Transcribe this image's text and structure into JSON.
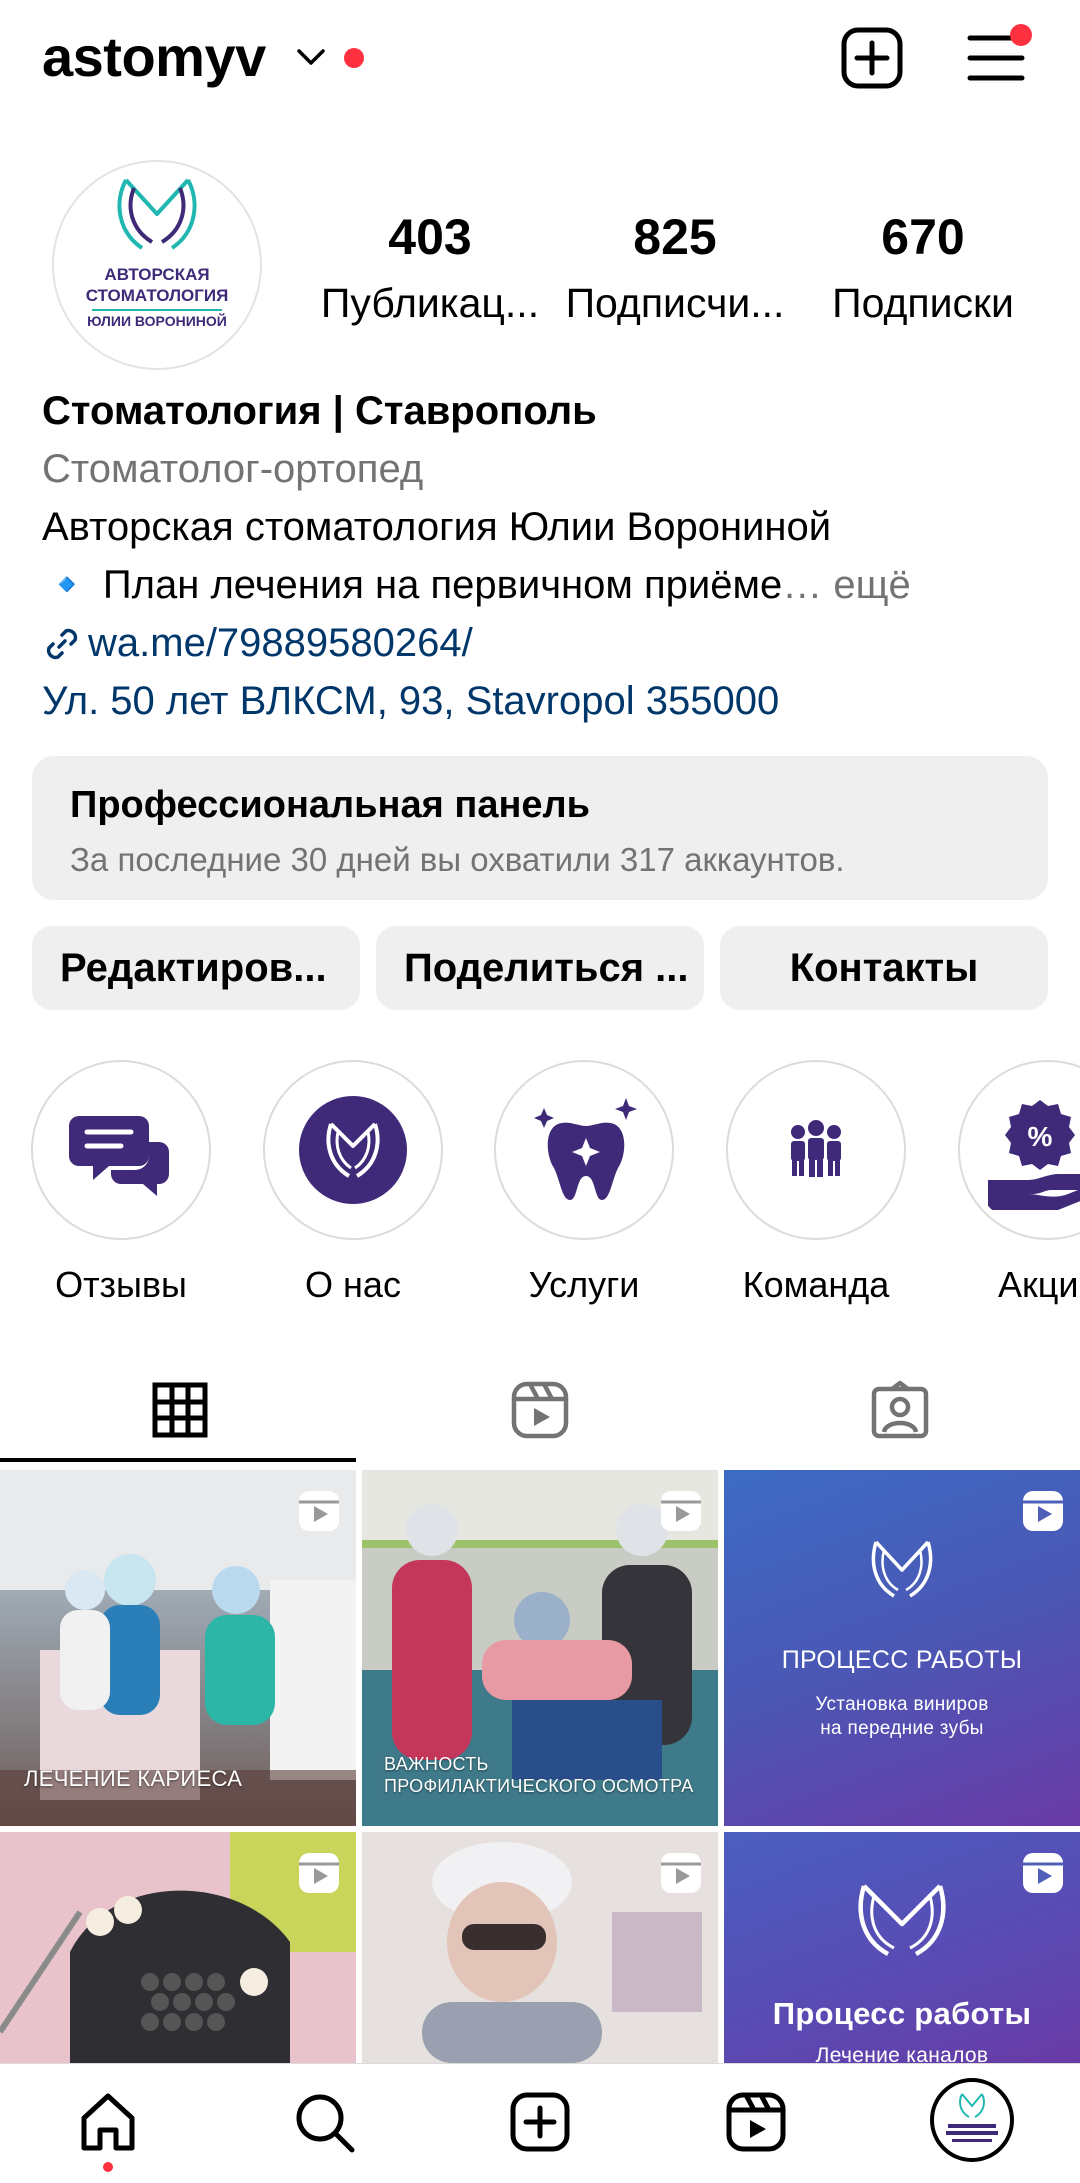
{
  "header": {
    "username": "astomyv"
  },
  "profile": {
    "avatar_text": [
      "АВТОРСКАЯ",
      "СТОМАТОЛОГИЯ",
      "ЮЛИИ ВОРОНИНОЙ"
    ],
    "stats": [
      {
        "value": "403",
        "label": "Публикац..."
      },
      {
        "value": "825",
        "label": "Подписчи..."
      },
      {
        "value": "670",
        "label": "Подписки"
      }
    ],
    "name": "Стоматология | Ставрополь",
    "category": "Стоматолог-ортопед",
    "bio_line1": "Авторская стоматология Юлии Ворониной",
    "bio_line2": "🔹 План лечения на первичном приёме",
    "more": "… ещё",
    "link": "wa.me/79889580264/",
    "address": "Ул. 50 лет ВЛКСМ, 93, Stavropol 355000"
  },
  "pro_panel": {
    "title": "Профессиональная панель",
    "subtitle": "За последние 30 дней вы охватили 317 аккаунтов."
  },
  "buttons": {
    "edit": "Редактиров...",
    "share": "Поделиться ...",
    "contacts": "Контакты"
  },
  "highlights": [
    {
      "label": "Отзывы",
      "icon": "chat-bubbles-icon"
    },
    {
      "label": "О нас",
      "icon": "tooth-logo-icon"
    },
    {
      "label": "Услуги",
      "icon": "tooth-sparkle-icon"
    },
    {
      "label": "Команда",
      "icon": "team-icon"
    },
    {
      "label": "Акци",
      "icon": "discount-hand-icon"
    }
  ],
  "grid": {
    "post1_caption": "ЛЕЧЕНИЕ КАРИЕСА",
    "post2_caption_1": "ВАЖНОСТЬ",
    "post2_caption_2": "ПРОФИЛАКТИЧЕСКОГО ОСМОТРА",
    "post3_title": "ПРОЦЕСС РАБОТЫ",
    "post3_sub_1": "Установка виниров",
    "post3_sub_2": "на передние зубы",
    "post6_title": "Процесс работы",
    "post6_sub": "Лечение каналов"
  },
  "colors": {
    "notification_red": "#ff3040",
    "link_blue": "#00376b",
    "brand_purple": "#3e2a78",
    "panel_gray": "#efefef"
  }
}
